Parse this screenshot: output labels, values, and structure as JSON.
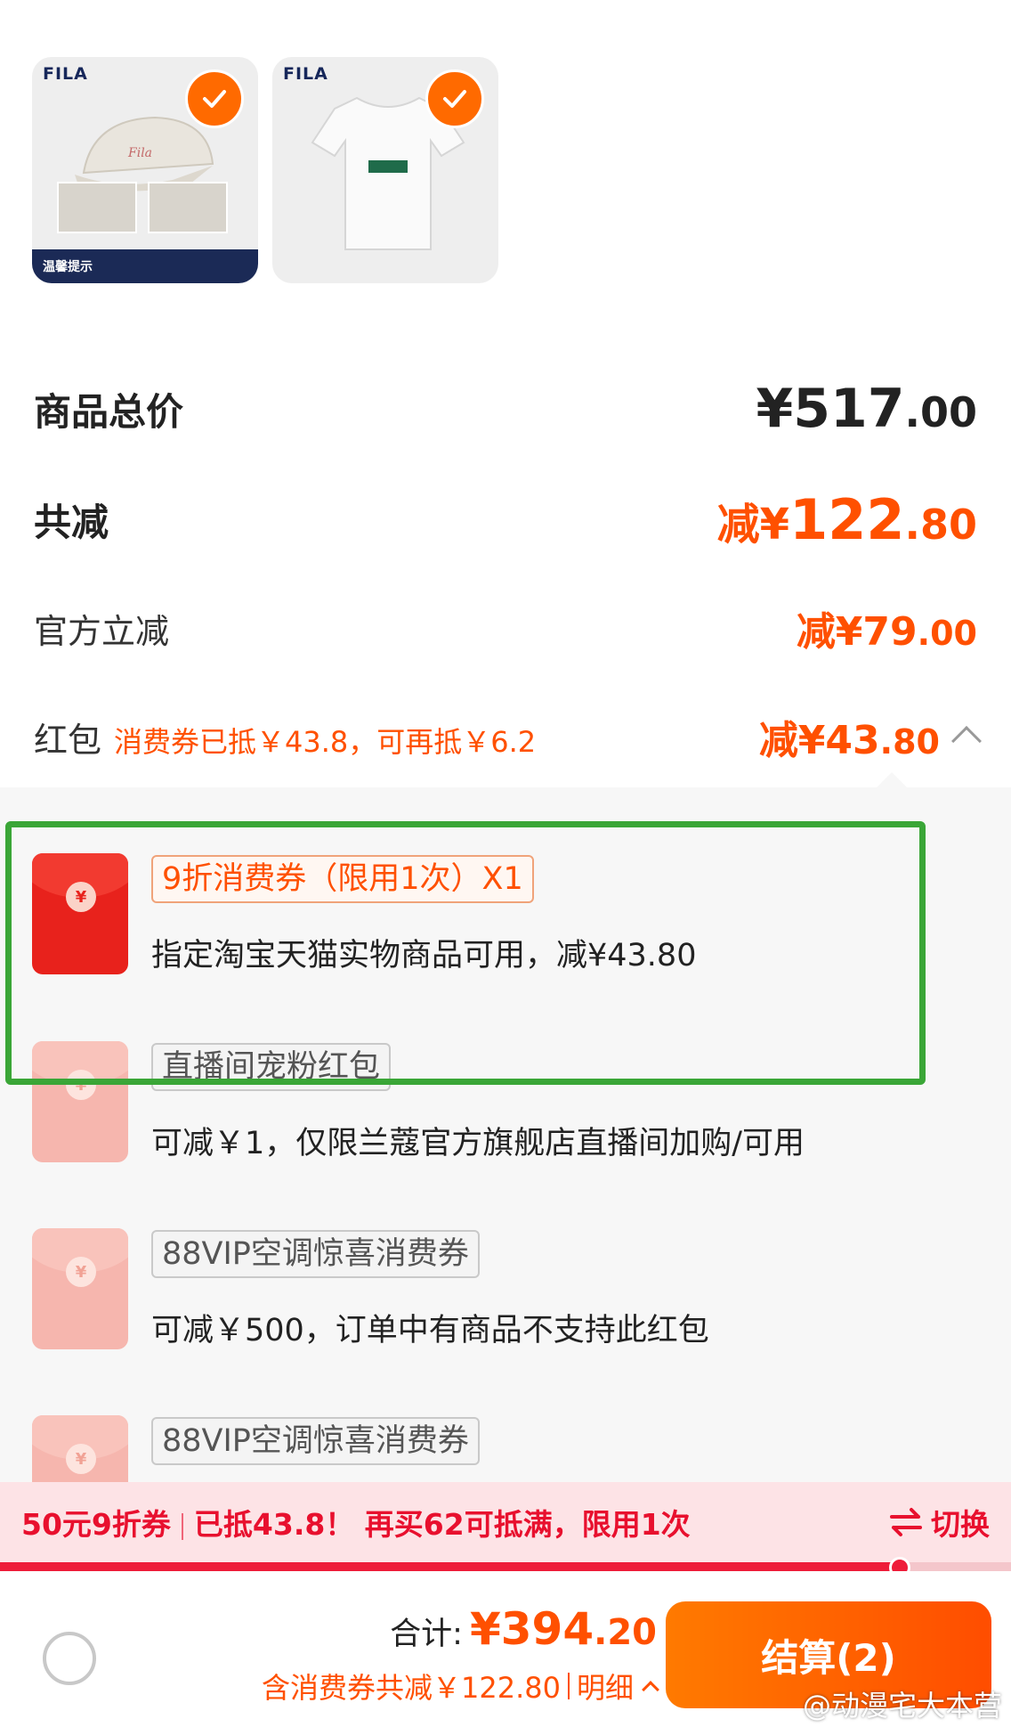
{
  "products": [
    {
      "brand": "FILA",
      "banner": "温馨提示",
      "selected": true
    },
    {
      "brand": "FILA",
      "selected": true
    }
  ],
  "summary": {
    "total_label": "商品总价",
    "total_main": "¥517",
    "total_dec": ".00",
    "discount_label": "共减",
    "discount_pre": "减¥",
    "discount_main": "122",
    "discount_dec": ".80",
    "official_label": "官方立减",
    "official_main": "减¥79",
    "official_dec": ".00",
    "redpacket_label": "红包",
    "redpacket_note": "消费券已抵￥43.8，可再抵￥6.2",
    "redpacket_main": "减¥43",
    "redpacket_dec": ".80"
  },
  "coupons": [
    {
      "tag": "9折消费券（限用1次）X1",
      "desc": "指定淘宝天猫实物商品可用，减¥43.80",
      "enabled": true
    },
    {
      "tag": "直播间宠粉红包",
      "desc": "可减￥1，仅限兰蔻官方旗舰店直播间加购/可用",
      "enabled": false
    },
    {
      "tag": "88VIP空调惊喜消费券",
      "desc": "可减￥500，订单中有商品不支持此红包",
      "enabled": false
    },
    {
      "tag": "88VIP空调惊喜消费券",
      "desc": "",
      "enabled": false
    }
  ],
  "promo": {
    "part1": "50元9折券",
    "part2": "已抵43.8！ 再买62可抵满，限用1次",
    "switch_label": "切换",
    "progress_percent": 89
  },
  "footer": {
    "sum_label": "合计:",
    "sum_main": "¥394",
    "sum_dec": ".20",
    "sub_label": "含消费券共减￥122.80",
    "detail_label": "明细",
    "pay_label": "结算(2)",
    "watermark": "@动漫宅大本营"
  },
  "colors": {
    "accent": "#ff5000",
    "promo": "#e8102e",
    "highlight": "#3aa637"
  }
}
